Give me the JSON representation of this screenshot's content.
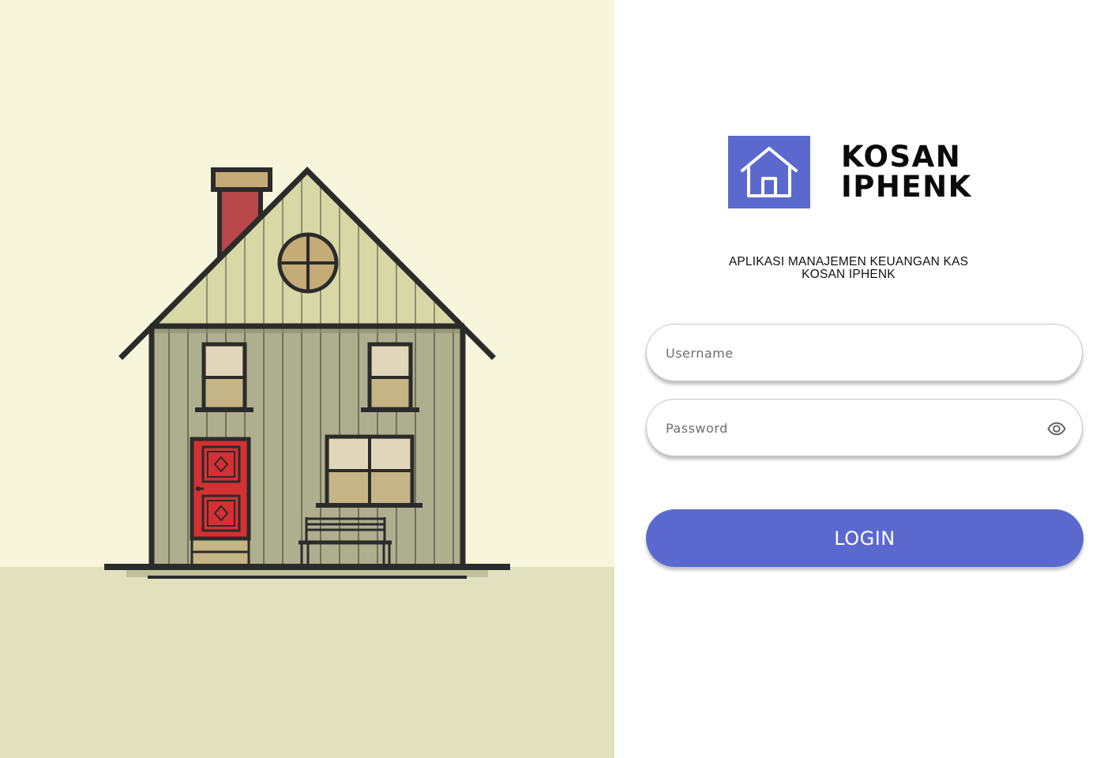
{
  "app": {
    "name": "KOSAN IPHENK",
    "subtitle": "APLIKASI MANAJEMEN KEUANGAN KAS KOSAN IPHENK",
    "logo_icon": "house-icon",
    "accent_color": "#5b69cf"
  },
  "illustration": {
    "subject": "house-illustration",
    "background_color": "#f7f6dc",
    "ground_color": "#e1e1bf"
  },
  "form": {
    "username": {
      "placeholder": "Username",
      "value": ""
    },
    "password": {
      "placeholder": "Password",
      "value": "",
      "toggle_icon": "eye-icon"
    },
    "login_label": "LOGIN"
  }
}
